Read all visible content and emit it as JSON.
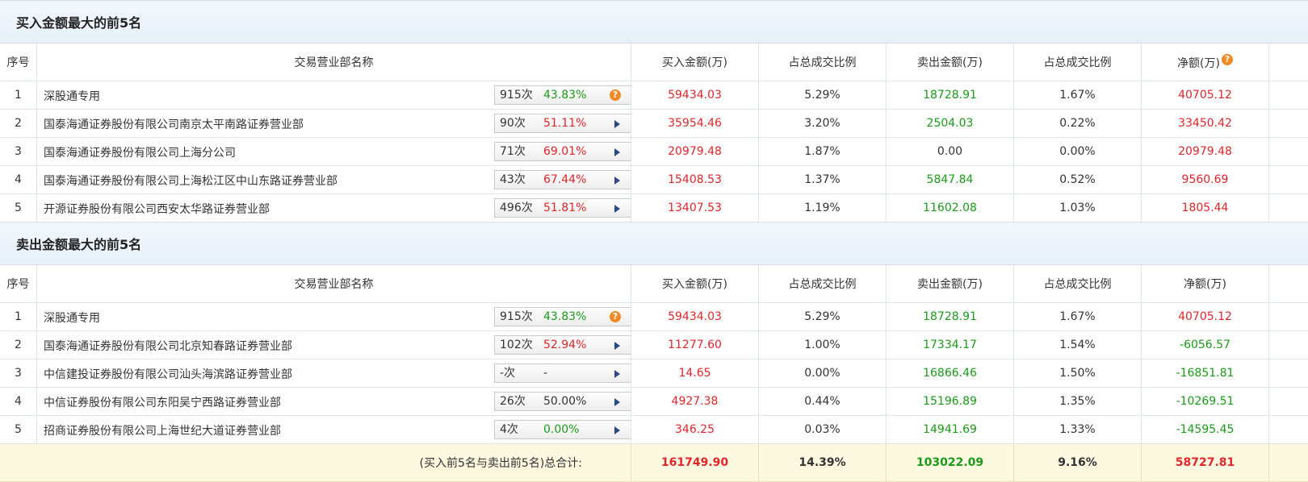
{
  "colors": {
    "red": "#e0262b",
    "green": "#1a9b1a",
    "header_bg": "#eaf2fa",
    "total_bg": "#fdf8e0"
  },
  "icons": {
    "help": "question-circle-icon",
    "expand": "play-arrow-icon"
  },
  "columns": {
    "seq": "序号",
    "name": "交易营业部名称",
    "buy": "买入金额(万)",
    "buy_ratio": "占总成交比例",
    "sell": "卖出金额(万)",
    "sell_ratio": "占总成交比例",
    "net": "净额(万)"
  },
  "help_glyph": "?",
  "buy_section": {
    "title": "买入金额最大的前5名",
    "rows": [
      {
        "seq": "1",
        "name": "深股通专用",
        "count": "915次",
        "pct": "43.83%",
        "buy": "59434.03",
        "buy_ratio": "5.29%",
        "sell": "18728.91",
        "sell_ratio": "1.67%",
        "net": "40705.12"
      },
      {
        "seq": "2",
        "name": "国泰海通证券股份有限公司南京太平南路证券营业部",
        "count": "90次",
        "pct": "51.11%",
        "buy": "35954.46",
        "buy_ratio": "3.20%",
        "sell": "2504.03",
        "sell_ratio": "0.22%",
        "net": "33450.42"
      },
      {
        "seq": "3",
        "name": "国泰海通证券股份有限公司上海分公司",
        "count": "71次",
        "pct": "69.01%",
        "buy": "20979.48",
        "buy_ratio": "1.87%",
        "sell": "0.00",
        "sell_ratio": "0.00%",
        "net": "20979.48"
      },
      {
        "seq": "4",
        "name": "国泰海通证券股份有限公司上海松江区中山东路证券营业部",
        "count": "43次",
        "pct": "67.44%",
        "buy": "15408.53",
        "buy_ratio": "1.37%",
        "sell": "5847.84",
        "sell_ratio": "0.52%",
        "net": "9560.69"
      },
      {
        "seq": "5",
        "name": "开源证券股份有限公司西安太华路证券营业部",
        "count": "496次",
        "pct": "51.81%",
        "buy": "13407.53",
        "buy_ratio": "1.19%",
        "sell": "11602.08",
        "sell_ratio": "1.03%",
        "net": "1805.44"
      }
    ]
  },
  "sell_section": {
    "title": "卖出金额最大的前5名",
    "rows": [
      {
        "seq": "1",
        "name": "深股通专用",
        "count": "915次",
        "pct": "43.83%",
        "buy": "59434.03",
        "buy_ratio": "5.29%",
        "sell": "18728.91",
        "sell_ratio": "1.67%",
        "net": "40705.12"
      },
      {
        "seq": "2",
        "name": "国泰海通证券股份有限公司北京知春路证券营业部",
        "count": "102次",
        "pct": "52.94%",
        "buy": "11277.60",
        "buy_ratio": "1.00%",
        "sell": "17334.17",
        "sell_ratio": "1.54%",
        "net": "-6056.57"
      },
      {
        "seq": "3",
        "name": "中信建投证券股份有限公司汕头海滨路证券营业部",
        "count": "-次",
        "pct": "-",
        "buy": "14.65",
        "buy_ratio": "0.00%",
        "sell": "16866.46",
        "sell_ratio": "1.50%",
        "net": "-16851.81"
      },
      {
        "seq": "4",
        "name": "中信证券股份有限公司东阳吴宁西路证券营业部",
        "count": "26次",
        "pct": "50.00%",
        "buy": "4927.38",
        "buy_ratio": "0.44%",
        "sell": "15196.89",
        "sell_ratio": "1.35%",
        "net": "-10269.51"
      },
      {
        "seq": "5",
        "name": "招商证券股份有限公司上海世纪大道证券营业部",
        "count": "4次",
        "pct": "0.00%",
        "buy": "346.25",
        "buy_ratio": "0.03%",
        "sell": "14941.69",
        "sell_ratio": "1.33%",
        "net": "-14595.45"
      }
    ]
  },
  "total": {
    "label": "(买入前5名与卖出前5名)总合计:",
    "buy": "161749.90",
    "buy_ratio": "14.39%",
    "sell": "103022.09",
    "sell_ratio": "9.16%",
    "net": "58727.81"
  }
}
